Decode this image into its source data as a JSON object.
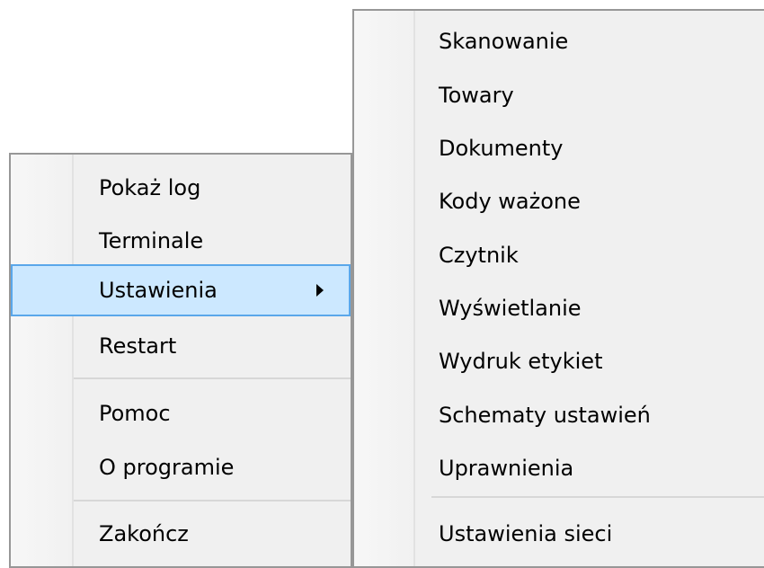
{
  "main_menu": {
    "items": [
      {
        "label": "Pokaż log"
      },
      {
        "label": "Terminale"
      },
      {
        "label": "Ustawienia",
        "has_submenu": true,
        "highlighted": true
      },
      {
        "label": "Restart"
      },
      {
        "label": "Pomoc"
      },
      {
        "label": "O programie"
      },
      {
        "label": "Zakończ"
      }
    ]
  },
  "submenu": {
    "parent": "Ustawienia",
    "items": [
      {
        "label": "Skanowanie"
      },
      {
        "label": "Towary"
      },
      {
        "label": "Dokumenty"
      },
      {
        "label": "Kody ważone"
      },
      {
        "label": "Czytnik"
      },
      {
        "label": "Wyświetlanie"
      },
      {
        "label": "Wydruk etykiet"
      },
      {
        "label": "Schematy ustawień"
      },
      {
        "label": "Uprawnienia"
      },
      {
        "label": "Ustawienia sieci"
      }
    ]
  },
  "colors": {
    "menu_background": "#f0f0f0",
    "highlight_fill": "#cce8ff",
    "highlight_border": "#5aa7ea",
    "menu_border": "#979797"
  }
}
